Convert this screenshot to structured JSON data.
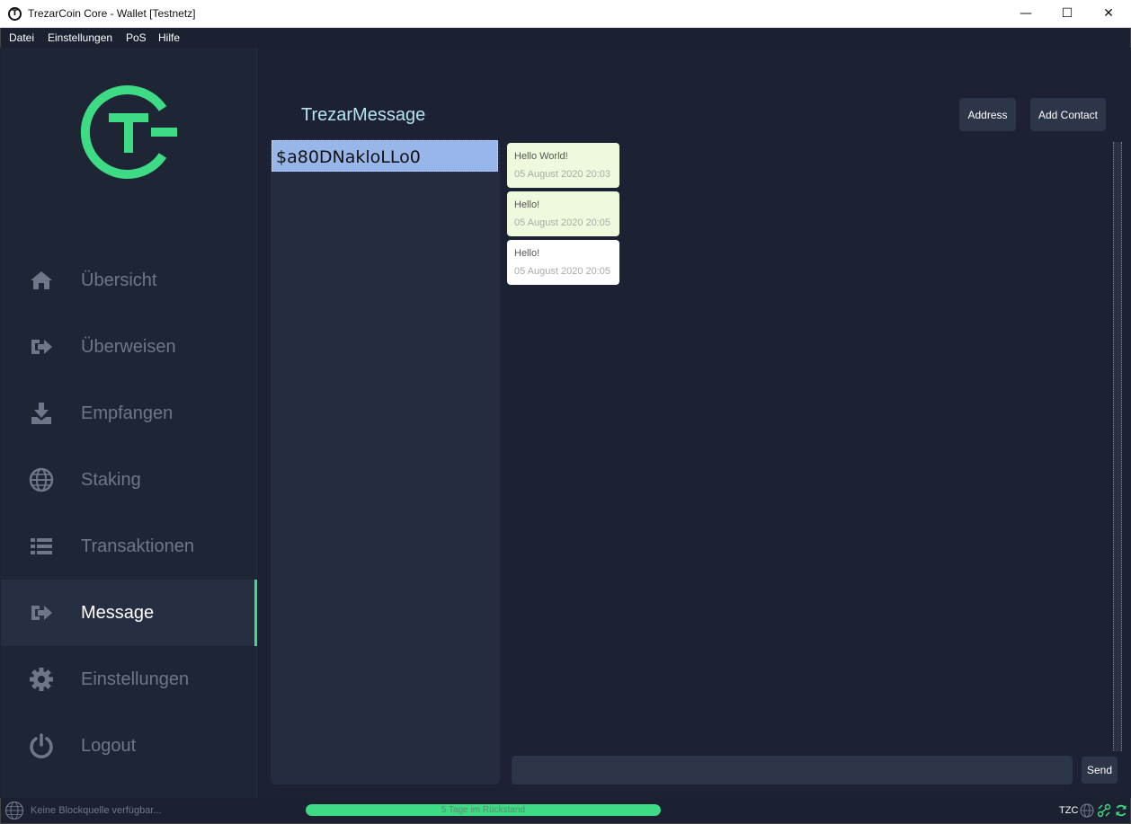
{
  "window": {
    "title": "TrezarCoin Core - Wallet [Testnetz]",
    "logo_letter": "T",
    "minimize": "—",
    "maximize": "☐",
    "close": "✕"
  },
  "menu": [
    "Datei",
    "Einstellungen",
    "PoS",
    "Hilfe"
  ],
  "sidebar": {
    "items": [
      {
        "label": "Übersicht",
        "icon": "home-icon",
        "active": false
      },
      {
        "label": "Überweisen",
        "icon": "sign-out-icon",
        "active": false
      },
      {
        "label": "Empfangen",
        "icon": "download-icon",
        "active": false
      },
      {
        "label": "Staking",
        "icon": "globe-icon",
        "active": false
      },
      {
        "label": "Transaktionen",
        "icon": "list-icon",
        "active": false
      },
      {
        "label": "Message",
        "icon": "sign-out-icon",
        "active": true
      },
      {
        "label": "Einstellungen",
        "icon": "gear-icon",
        "active": false
      },
      {
        "label": "Logout",
        "icon": "power-icon",
        "active": false
      }
    ]
  },
  "main": {
    "title": "TrezarMessage",
    "address_button": "Address",
    "add_contact_button": "Add Contact",
    "contacts": [
      "$a80DNakloLLo0"
    ],
    "messages": [
      {
        "text": "Hello World!",
        "time": "05 August 2020 20:03",
        "style": "green"
      },
      {
        "text": "Hello!",
        "time": "05 August 2020 20:05",
        "style": "green"
      },
      {
        "text": "Hello!",
        "time": "05 August 2020 20:05",
        "style": "white"
      }
    ],
    "input_value": "",
    "send_button": "Send"
  },
  "status": {
    "source_text": "Keine Blockquelle verfügbar...",
    "progress_label": "5 Tage im Rückstand",
    "progress_percent": 100,
    "unit": "TZC"
  },
  "colors": {
    "accent": "#3ddc84",
    "background": "#1c2233",
    "sidebar": "#1e2535",
    "selected_contact": "#99b6ea",
    "title": "#b7e3f1"
  }
}
